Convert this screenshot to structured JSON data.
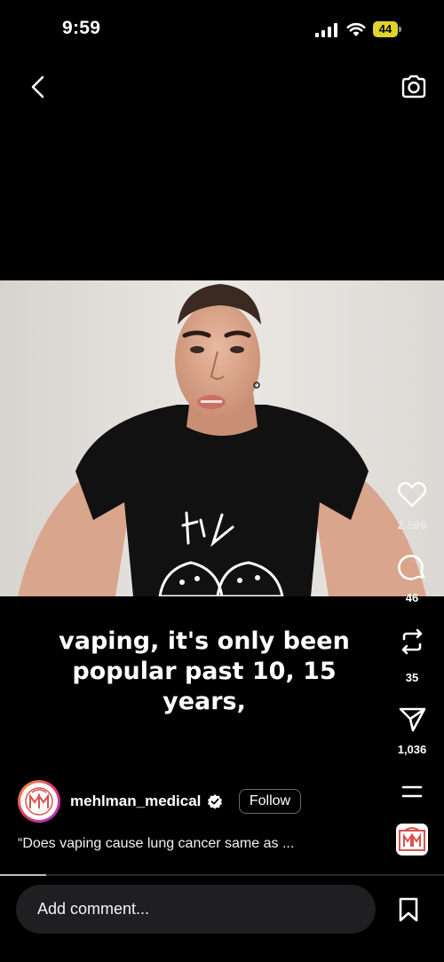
{
  "status_bar": {
    "time": "9:59",
    "battery_level": "44",
    "battery_color": "#e0d32b"
  },
  "nav": {
    "back_icon": "chevron-left-icon",
    "camera_icon": "camera-icon"
  },
  "video": {
    "caption_line1": "vaping, it's only been",
    "caption_line2": "popular past 10, 15 years,"
  },
  "actions": {
    "likes": "2,599",
    "comments": "46",
    "reposts": "35",
    "shares": "1,036"
  },
  "author": {
    "username": "mehlman_medical",
    "follow_label": "Follow",
    "description": "“Does vaping cause lung cancer same as ...",
    "avatar_text": "MM"
  },
  "playback": {
    "progress": 0.104
  },
  "comment_bar": {
    "placeholder": "Add comment..."
  },
  "colors": {
    "background": "#000000",
    "input_bg": "#1f1f21",
    "avatar_ring": "#e1306c",
    "logo_red": "#d9534f"
  }
}
